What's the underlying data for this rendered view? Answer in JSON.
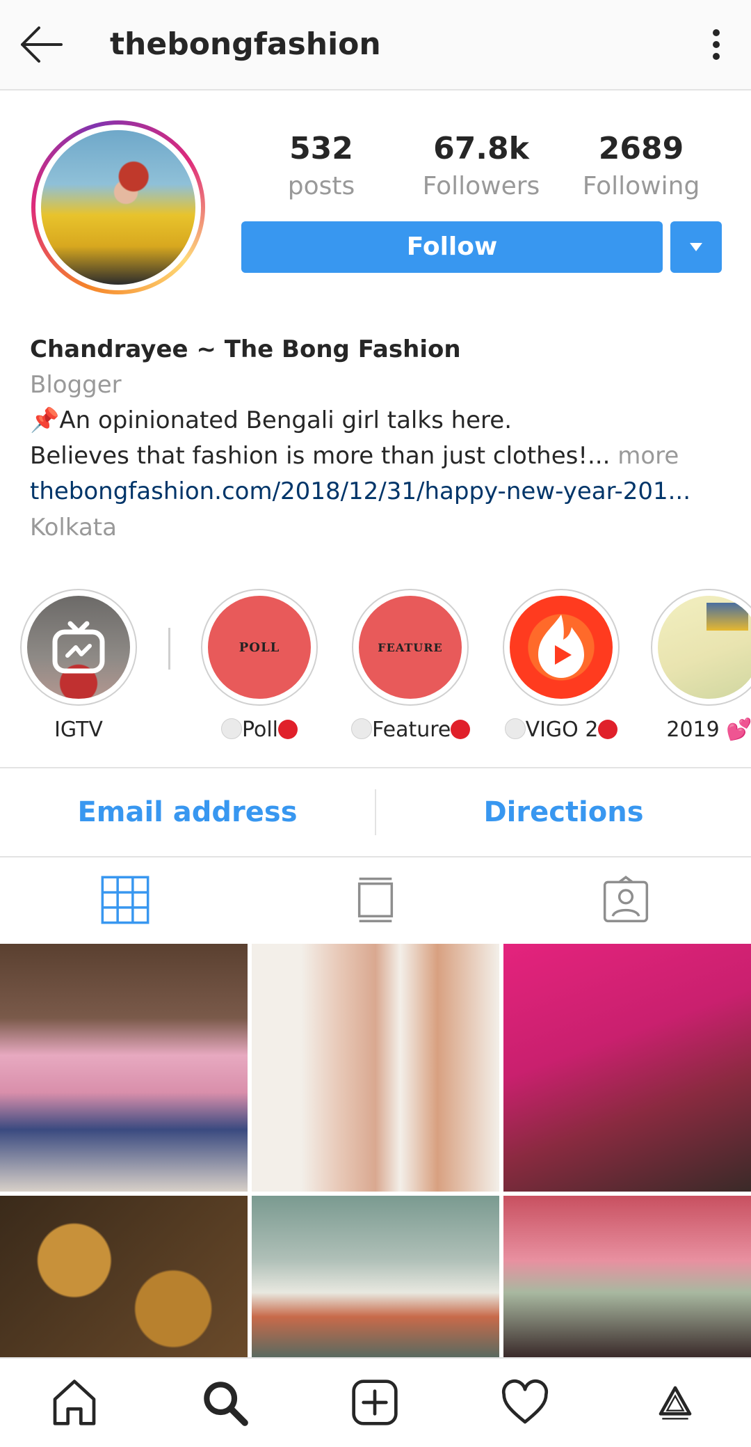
{
  "header": {
    "username": "thebongfashion"
  },
  "stats": [
    {
      "value": "532",
      "label": "posts"
    },
    {
      "value": "67.8k",
      "label": "Followers"
    },
    {
      "value": "2689",
      "label": "Following"
    }
  ],
  "actions": {
    "follow_label": "Follow"
  },
  "bio": {
    "name": "Chandrayee ~ The Bong Fashion",
    "category": "Blogger",
    "line1": "📌An opinionated Bengali girl talks here.",
    "line2": "Believes that fashion is more than just clothes!...",
    "more": "more",
    "link": "thebongfashion.com/2018/12/31/happy-new-year-201...",
    "location": "Kolkata"
  },
  "highlights": [
    {
      "label": "IGTV",
      "icon": "igtv-icon"
    },
    {
      "label": "Poll",
      "cover_text": "POLL"
    },
    {
      "label": "Feature",
      "cover_text": "FEATURE"
    },
    {
      "label": "VIGO 2",
      "icon": "vigo-play-icon"
    },
    {
      "label": "2019 💕"
    }
  ],
  "contact": {
    "email_label": "Email address",
    "directions_label": "Directions"
  },
  "colors": {
    "accent": "#3897f0",
    "highlight_red": "#e85a5a",
    "link": "#003569",
    "muted": "#999999"
  }
}
